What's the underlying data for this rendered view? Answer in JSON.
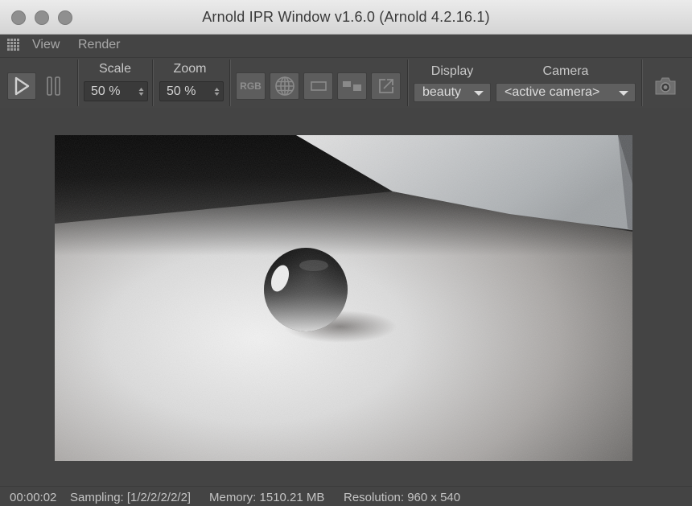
{
  "window": {
    "title": "Arnold IPR Window v1.6.0 (Arnold 4.2.16.1)"
  },
  "menu": {
    "items": [
      "View",
      "Render"
    ]
  },
  "toolbar": {
    "scale": {
      "label": "Scale",
      "value": "50 %"
    },
    "zoom": {
      "label": "Zoom",
      "value": "50 %"
    },
    "rgb_label": "RGB",
    "display": {
      "label": "Display",
      "value": "beauty"
    },
    "camera": {
      "label": "Camera",
      "value": "<active camera>"
    }
  },
  "icons": {
    "play": "play-icon",
    "pause": "pause-icon",
    "rgb": "rgb-channel-icon",
    "globe": "globe-icon",
    "region": "region-icon",
    "compare": "compare-icon",
    "export": "export-icon",
    "snapshot": "camera-snapshot-icon"
  },
  "status": {
    "time": "00:00:02",
    "sampling": "Sampling: [1/2/2/2/2/2]",
    "memory": "Memory: 1510.21 MB",
    "resolution": "Resolution: 960 x 540"
  }
}
